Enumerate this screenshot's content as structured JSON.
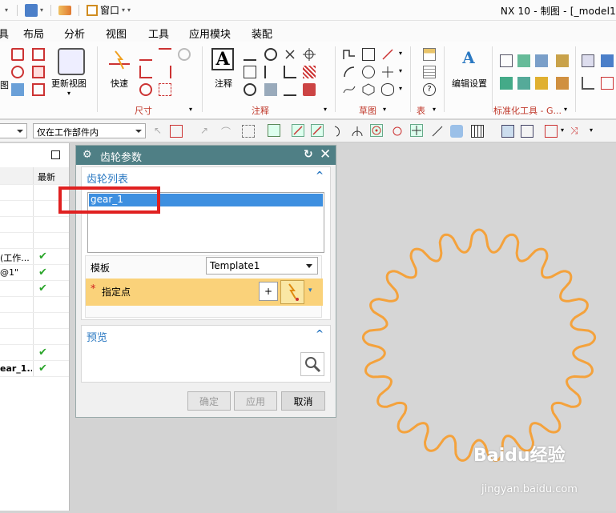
{
  "titlebar": {
    "window_menu_label": "窗口",
    "window_title": "NX 10 - 制图 - [_model1"
  },
  "menus": [
    "具",
    "布局",
    "分析",
    "视图",
    "工具",
    "应用模块",
    "装配"
  ],
  "ribbon": {
    "update_view_label": "更新视图",
    "quick_label": "快速",
    "dimension_group": "尺寸",
    "note_label": "注释",
    "annotation_group": "注释",
    "sketch_group": "草图",
    "table_group": "表",
    "edit_settings_label": "编辑设置",
    "std_tools_group": "标准化工具 - G...",
    "left_cut_label": "图"
  },
  "selbar": {
    "filter_value": "仅在工作部件内"
  },
  "navigator": {
    "header_latest": "最新",
    "rows": [
      {
        "text": "",
        "check": false
      },
      {
        "text": "",
        "check": false
      },
      {
        "text": "",
        "check": false
      },
      {
        "text": "",
        "check": false
      },
      {
        "text": "(工作...",
        "check": true
      },
      {
        "text": "@1\"",
        "check": true
      },
      {
        "text": "",
        "check": true
      },
      {
        "text": "",
        "check": false
      },
      {
        "text": "",
        "check": false
      },
      {
        "text": "",
        "check": false
      },
      {
        "text": "",
        "check": true
      },
      {
        "text": "ear_1...",
        "check": true
      }
    ]
  },
  "dialog": {
    "title": "齿轮参数",
    "gear_list_header": "齿轮列表",
    "gear_items": [
      "gear_1"
    ],
    "template_label": "模板",
    "template_value": "Template1",
    "specify_point_label": "指定点",
    "required_mark": "*",
    "preview_header": "预览",
    "ok_label": "确定",
    "apply_label": "应用",
    "cancel_label": "取消"
  },
  "canvas": {
    "gear_color": "#f4a23c",
    "gear_teeth": 21
  },
  "watermark": {
    "brand": "Baidu经验",
    "url": "jingyan.baidu.com"
  },
  "colors": {
    "accent": "#2b79c2",
    "dialog_title_bg": "#4f7f85",
    "highlight_box": "#e02020",
    "selection": "#3d8fe0"
  }
}
